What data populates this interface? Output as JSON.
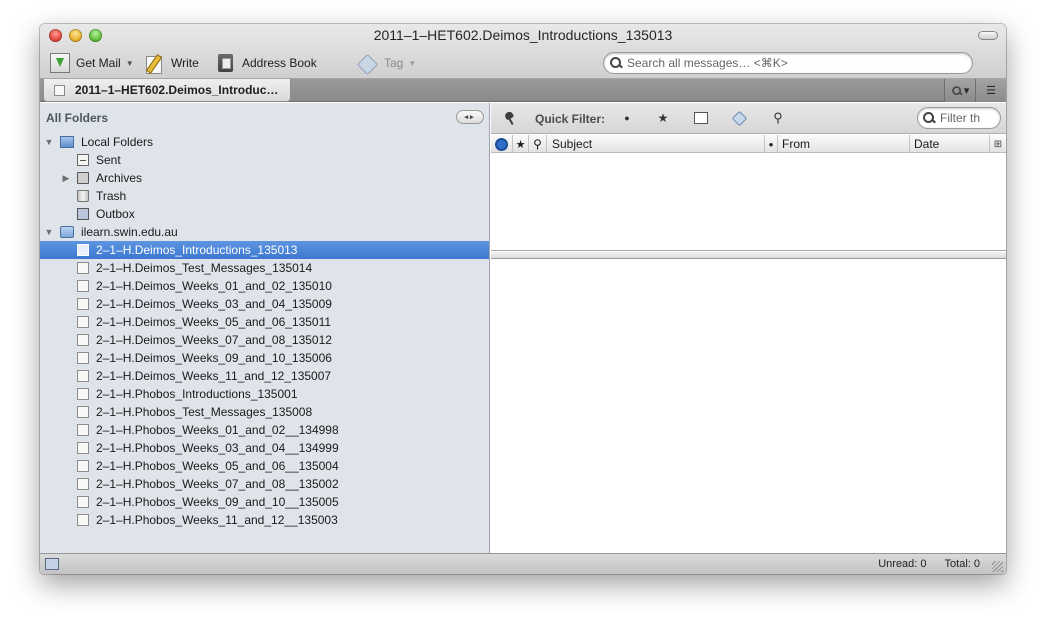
{
  "window": {
    "title": "2011–1–HET602.Deimos_Introductions_135013"
  },
  "toolbar": {
    "get_mail": "Get Mail",
    "write": "Write",
    "address_book": "Address Book",
    "tag": "Tag",
    "search_placeholder": "Search all messages… <⌘K>"
  },
  "tab": {
    "label": "2011–1–HET602.Deimos_Introduc…"
  },
  "folder_pane": {
    "header": "All Folders",
    "local_folders": {
      "label": "Local Folders",
      "children": [
        "Sent",
        "Archives",
        "Trash",
        "Outbox"
      ]
    },
    "account": {
      "label": "ilearn.swin.edu.au",
      "selected_index": 0,
      "folders": [
        "2–1–H.Deimos_Introductions_135013",
        "2–1–H.Deimos_Test_Messages_135014",
        "2–1–H.Deimos_Weeks_01_and_02_135010",
        "2–1–H.Deimos_Weeks_03_and_04_135009",
        "2–1–H.Deimos_Weeks_05_and_06_135011",
        "2–1–H.Deimos_Weeks_07_and_08_135012",
        "2–1–H.Deimos_Weeks_09_and_10_135006",
        "2–1–H.Deimos_Weeks_11_and_12_135007",
        "2–1–H.Phobos_Introductions_135001",
        "2–1–H.Phobos_Test_Messages_135008",
        "2–1–H.Phobos_Weeks_01_and_02__134998",
        "2–1–H.Phobos_Weeks_03_and_04__134999",
        "2–1–H.Phobos_Weeks_05_and_06__135004",
        "2–1–H.Phobos_Weeks_07_and_08__135002",
        "2–1–H.Phobos_Weeks_09_and_10__135005",
        "2–1–H.Phobos_Weeks_11_and_12__135003"
      ]
    }
  },
  "quick_filter": {
    "label": "Quick Filter:",
    "filter_placeholder": "Filter th"
  },
  "columns": {
    "subject": "Subject",
    "from": "From",
    "date": "Date"
  },
  "status": {
    "unread": "Unread: 0",
    "total": "Total: 0"
  },
  "icons": {
    "accent_selection": "#3d78d1",
    "folder_pane_bg": "#dfe4ea"
  }
}
